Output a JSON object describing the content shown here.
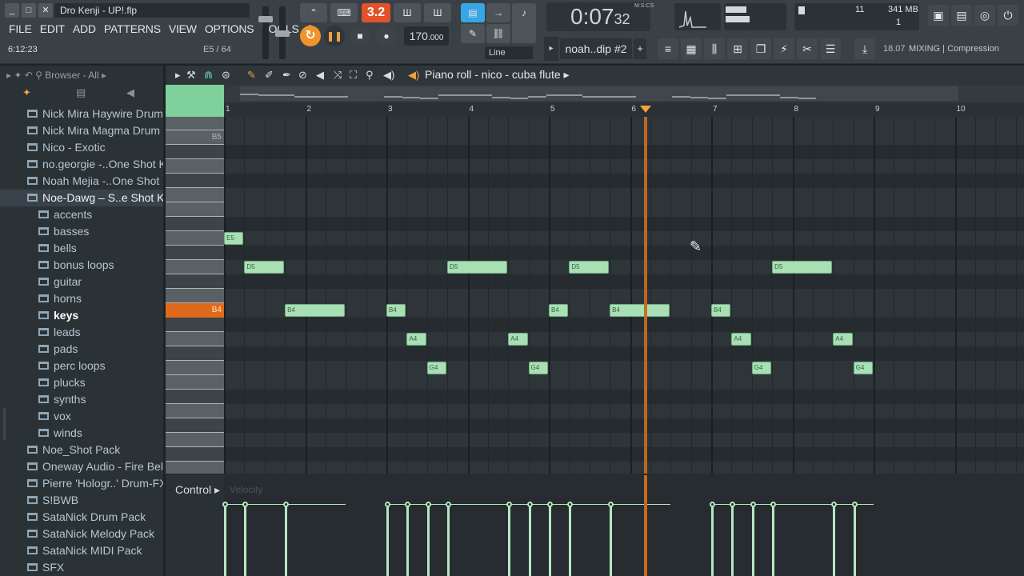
{
  "window": {
    "file_title": "Dro Kenji - UP!.flp",
    "min_label": "_",
    "max_label": "□",
    "close_label": "✕"
  },
  "menu": [
    "FILE",
    "EDIT",
    "ADD",
    "PATTERNS",
    "VIEW",
    "OPTIONS",
    "TOOLS",
    "?"
  ],
  "status": {
    "time_readout": "6:12:23",
    "pattern_hint": "E5 / 64"
  },
  "transport": {
    "pat_song": "3.2",
    "tempo_int": "170",
    "tempo_frac": ".000",
    "time_main": "0:07",
    "time_small": "32",
    "time_format": "M:S:CS",
    "snap": "Line",
    "pattern": "noah..dip #2"
  },
  "meters": {
    "cpu": "11",
    "memory": "341 MB",
    "voices": "1"
  },
  "hint_bar": {
    "number": "18.07",
    "text": "MIXING | Compression"
  },
  "browser": {
    "title": "Browser - All",
    "items": [
      {
        "label": "Nick Mira Haywire Drum Kit",
        "level": 0
      },
      {
        "label": "Nick Mira Magma Drum Kit",
        "level": 0
      },
      {
        "label": "Nico - Exotic",
        "level": 0
      },
      {
        "label": "no.georgie -..One Shot Kit)",
        "level": 0
      },
      {
        "label": "Noah Mejia -..One Shot Kit)",
        "level": 0
      },
      {
        "label": "Noe-Dawg – S..e Shot Kit)",
        "level": 0,
        "selected": true
      },
      {
        "label": "accents",
        "level": 1
      },
      {
        "label": "basses",
        "level": 1
      },
      {
        "label": "bells",
        "level": 1
      },
      {
        "label": "bonus loops",
        "level": 1
      },
      {
        "label": "guitar",
        "level": 1
      },
      {
        "label": "horns",
        "level": 1
      },
      {
        "label": "keys",
        "level": 1,
        "active": true
      },
      {
        "label": "leads",
        "level": 1
      },
      {
        "label": "pads",
        "level": 1
      },
      {
        "label": "perc loops",
        "level": 1
      },
      {
        "label": "plucks",
        "level": 1
      },
      {
        "label": "synths",
        "level": 1
      },
      {
        "label": "vox",
        "level": 1
      },
      {
        "label": "winds",
        "level": 1
      },
      {
        "label": "Noe_Shot Pack",
        "level": 0
      },
      {
        "label": "Oneway Audio - Fire Bells",
        "level": 0
      },
      {
        "label": "Pierre 'Hologr..' Drum-FX Kit",
        "level": 0
      },
      {
        "label": "S!BWB",
        "level": 0
      },
      {
        "label": "SataNick Drum Pack",
        "level": 0
      },
      {
        "label": "SataNick Melody Pack",
        "level": 0
      },
      {
        "label": "SataNick MIDI Pack",
        "level": 0
      },
      {
        "label": "SFX",
        "level": 0
      }
    ]
  },
  "piano_roll": {
    "title": "Piano roll - nico - cuba flute",
    "bars": [
      "1",
      "2",
      "3",
      "4",
      "5",
      "6",
      "7",
      "8",
      "9",
      "10"
    ],
    "key_labels": {
      "B5": "B5",
      "B4": "B4"
    },
    "highlight_key": "B4",
    "playhead_bar": 6.17,
    "control_label": "Control",
    "control_param": "Velocity",
    "notes": [
      {
        "pitch": "E5",
        "start": 1.0,
        "len": 0.25
      },
      {
        "pitch": "D5",
        "start": 1.25,
        "len": 0.5
      },
      {
        "pitch": "B4",
        "start": 1.75,
        "len": 0.75
      },
      {
        "pitch": "B4",
        "start": 3.0,
        "len": 0.25
      },
      {
        "pitch": "A4",
        "start": 3.25,
        "len": 0.25
      },
      {
        "pitch": "G4",
        "start": 3.5,
        "len": 0.25
      },
      {
        "pitch": "D5",
        "start": 3.75,
        "len": 0.75
      },
      {
        "pitch": "A4",
        "start": 4.5,
        "len": 0.25
      },
      {
        "pitch": "G4",
        "start": 4.75,
        "len": 0.25
      },
      {
        "pitch": "B4",
        "start": 5.0,
        "len": 0.25
      },
      {
        "pitch": "D5",
        "start": 5.25,
        "len": 0.5
      },
      {
        "pitch": "B4",
        "start": 5.75,
        "len": 0.75
      },
      {
        "pitch": "B4",
        "start": 7.0,
        "len": 0.25
      },
      {
        "pitch": "A4",
        "start": 7.25,
        "len": 0.25
      },
      {
        "pitch": "G4",
        "start": 7.5,
        "len": 0.25
      },
      {
        "pitch": "D5",
        "start": 7.75,
        "len": 0.75
      },
      {
        "pitch": "A4",
        "start": 8.5,
        "len": 0.25
      },
      {
        "pitch": "G4",
        "start": 8.75,
        "len": 0.25
      }
    ]
  },
  "colors": {
    "note_fill": "#a9e0b3",
    "playhead": "#c56a20",
    "highlight_key": "#e06a1c",
    "accent_orange": "#f0932a"
  }
}
